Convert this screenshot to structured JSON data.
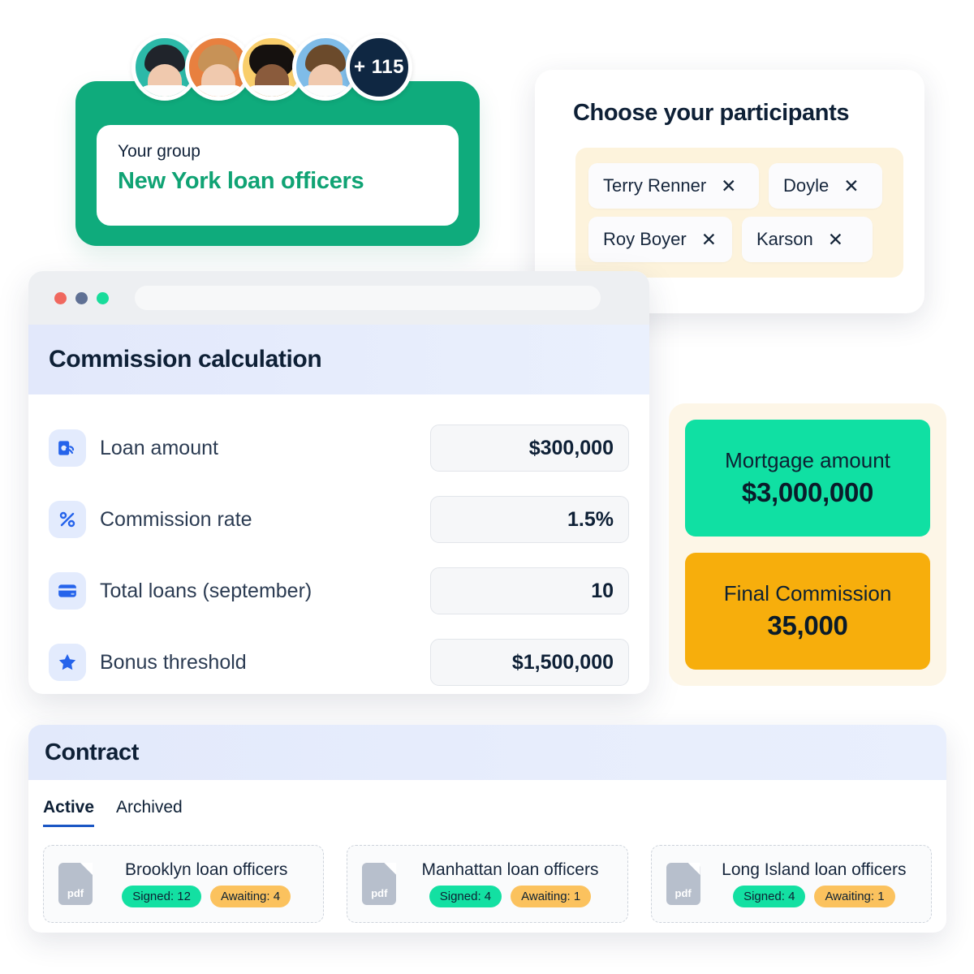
{
  "group_card": {
    "label": "Your group",
    "name": "New York loan officers",
    "overflow_badge": "+ 115",
    "accent_color": "#0FAB7C",
    "name_color": "#10A374",
    "avatars": [
      {
        "name": "avatar-1",
        "bg": "#2CB9A8",
        "hair": "#20242B"
      },
      {
        "name": "avatar-2",
        "bg": "#E8803F",
        "hair": "#C79257"
      },
      {
        "name": "avatar-3",
        "bg": "#F9CE6B",
        "hair": "#15110F"
      },
      {
        "name": "avatar-4",
        "bg": "#7FBCE8",
        "hair": "#6B4A2B"
      }
    ]
  },
  "participants": {
    "title": "Choose your participants",
    "panel_bg": "#FDF3DC",
    "chips": [
      {
        "label": "Terry Renner",
        "remove": "✕"
      },
      {
        "label": "Doyle",
        "remove": "✕"
      },
      {
        "label": "Roy Boyer",
        "remove": "✕"
      },
      {
        "label": "Karson",
        "remove": "✕"
      }
    ]
  },
  "browser": {
    "url_value": "",
    "url_placeholder": "",
    "dots": [
      "#F0685F",
      "#5F7094",
      "#19DC9B"
    ]
  },
  "calculator": {
    "title": "Commission calculation",
    "rows": [
      {
        "icon": "money-hand-icon",
        "label": "Loan amount",
        "value": "$300,000"
      },
      {
        "icon": "percent-icon",
        "label": "Commission rate",
        "value": "1.5%"
      },
      {
        "icon": "credit-card-icon",
        "label": "Total loans (september)",
        "value": "10"
      },
      {
        "icon": "star-icon",
        "label": "Bonus threshold",
        "value": "$1,500,000"
      }
    ]
  },
  "results": {
    "panel_bg": "#FDF6E7",
    "cards": [
      {
        "label": "Mortgage amount",
        "value": "$3,000,000",
        "color": "#10E0A3"
      },
      {
        "label": "Final Commission",
        "value": "35,000",
        "color": "#F7AE0C"
      }
    ]
  },
  "contract": {
    "title": "Contract",
    "tabs": [
      {
        "label": "Active",
        "selected": true
      },
      {
        "label": "Archived",
        "selected": false
      }
    ],
    "active_tab_underline_color": "#1A56C4",
    "cards": [
      {
        "file_type": "pdf",
        "name": "Brooklyn loan officers",
        "signed": "Signed: 12",
        "awaiting": "Awaiting: 4"
      },
      {
        "file_type": "pdf",
        "name": "Manhattan loan officers",
        "signed": "Signed: 4",
        "awaiting": "Awaiting: 1"
      },
      {
        "file_type": "pdf",
        "name": "Long Island loan officers",
        "signed": "Signed: 4",
        "awaiting": "Awaiting: 1"
      }
    ]
  }
}
